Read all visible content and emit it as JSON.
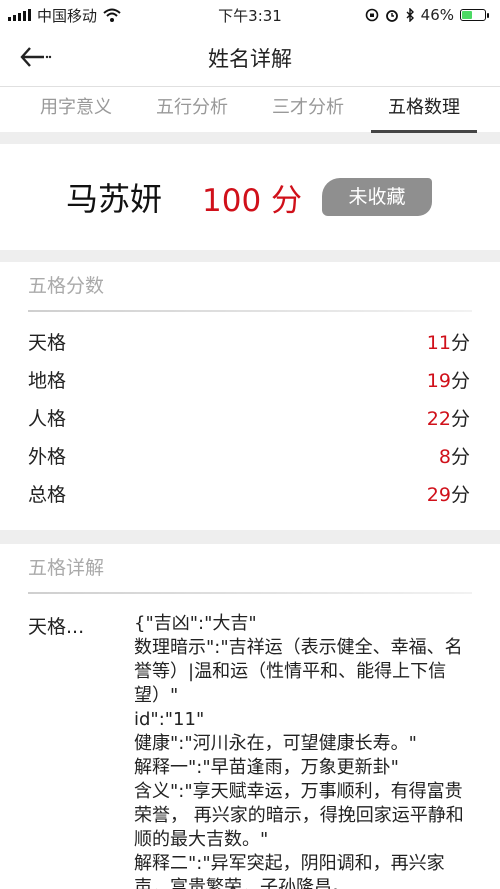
{
  "status_bar": {
    "carrier": "中国移动",
    "time": "下午3:31",
    "battery_percent": "46%",
    "battery_level": 0.46
  },
  "nav": {
    "title": "姓名详解"
  },
  "tabs": [
    {
      "label": "用字意义",
      "active": false
    },
    {
      "label": "五行分析",
      "active": false
    },
    {
      "label": "三才分析",
      "active": false
    },
    {
      "label": "五格数理",
      "active": true
    }
  ],
  "name_card": {
    "name": "马苏妍",
    "score": "100 分",
    "favorite_label": "未收藏"
  },
  "score_section": {
    "title": "五格分数",
    "unit": "分",
    "rows": [
      {
        "label": "天格",
        "value": "11"
      },
      {
        "label": "地格",
        "value": "19"
      },
      {
        "label": "人格",
        "value": "22"
      },
      {
        "label": "外格",
        "value": "8"
      },
      {
        "label": "总格",
        "value": "29"
      }
    ]
  },
  "detail_section": {
    "title": "五格详解",
    "label": "天格...",
    "text": "{\"吉凶\":\"大吉\"\n数理暗示\":\"吉祥运（表示健全、幸福、名誉等）|温和运（性情平和、能得上下信望）\"\nid\":\"11\"\n健康\":\"河川永在，可望健康长寿。\"\n解释一\":\"早苗逢雨，万象更新卦\"\n含义\":\"享天赋幸运，万事顺利，有得富贵荣誉， 再兴家的暗示，得挽回家运平静和顺的最大吉数。\"\n解释二\":\"异军突起，阴阳调和，再兴家声，富贵繁荣，子孙隆昌。"
  },
  "colors": {
    "accent_red": "#d0101a",
    "badge_gray": "#8f8f8f",
    "battery_green": "#4cd964"
  },
  "icons": [
    "signal-icon",
    "wifi-icon",
    "lock-rotation-icon",
    "alarm-icon",
    "bluetooth-icon",
    "battery-icon",
    "back-arrow-icon"
  ]
}
